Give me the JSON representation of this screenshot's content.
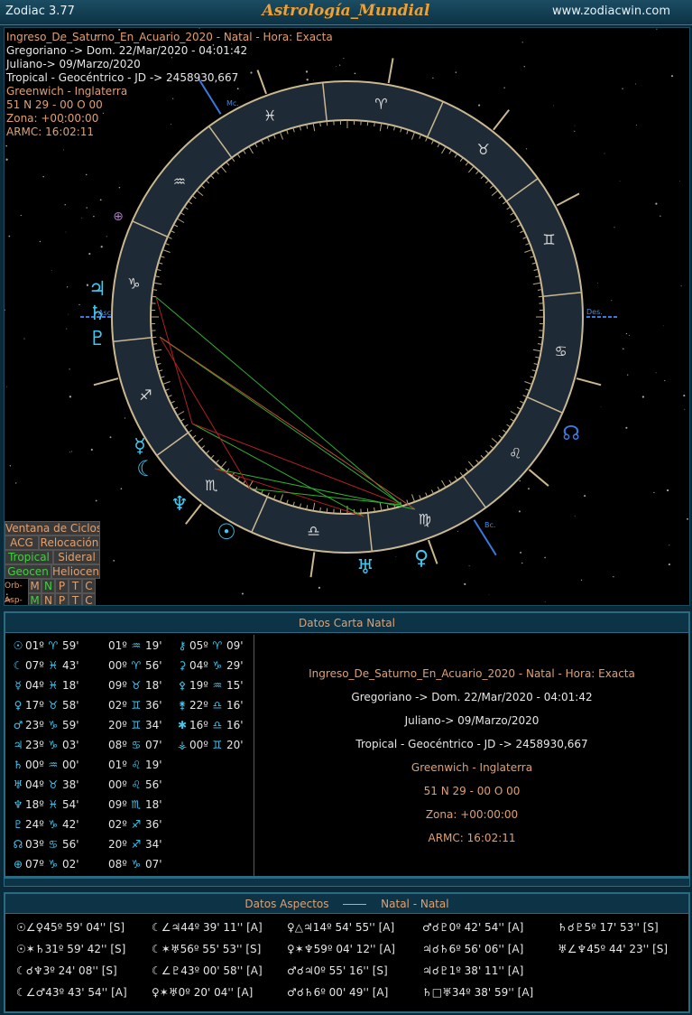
{
  "window": {
    "app_name": "Zodiac 3.77",
    "heading": "Astrología_Mundial",
    "url": "www.zodiacwin.com"
  },
  "chart_info": [
    "Ingreso_De_Saturno_En_Acuario_2020 - Natal - Hora: Exacta",
    "Gregoriano -> Dom. 22/Mar/2020 - 04:01:42",
    "Juliano-> 09/Marzo/2020",
    "Tropical - Geocéntrico - JD -> 2458930,667",
    "Greenwich - Inglaterra",
    "51 N 29 - 00 O 00",
    "Zona: +00:00:00",
    "ARMC: 16:02:11"
  ],
  "wheel": {
    "angle_labels": {
      "mc": "Mc.",
      "asc": "Asc",
      "des": "Des.",
      "bc": "Bc."
    },
    "signs": [
      "♑",
      "♒",
      "♓",
      "♈",
      "♉",
      "♊",
      "♋",
      "♌",
      "♍",
      "♎",
      "♏",
      "♐"
    ]
  },
  "controls": {
    "ventana_ciclos": "Ventana de Ciclos",
    "acg": "ACG",
    "relocacion": "Relocación",
    "tropical": "Tropical",
    "sideral": "Sideral",
    "geocen": "Geocen",
    "heliocen": "Heliocen",
    "orb_label": "Orb->",
    "asp_label": "Asp->",
    "letters": [
      "M",
      "N",
      "P",
      "T",
      "C"
    ]
  },
  "natal": {
    "header": "Datos Carta Natal",
    "col1": [
      {
        "g": "☉",
        "deg": "01º",
        "s": "♈",
        "min": "59'"
      },
      {
        "g": "☾",
        "deg": "07º",
        "s": "♓",
        "min": "43'"
      },
      {
        "g": "☿",
        "deg": "04º",
        "s": "♓",
        "min": "18'"
      },
      {
        "g": "♀",
        "deg": "17º",
        "s": "♉",
        "min": "58'"
      },
      {
        "g": "♂",
        "deg": "23º",
        "s": "♑",
        "min": "59'"
      },
      {
        "g": "♃",
        "deg": "23º",
        "s": "♑",
        "min": "03'"
      },
      {
        "g": "♄",
        "deg": "00º",
        "s": "♒",
        "min": "00'"
      },
      {
        "g": "♅",
        "deg": "04º",
        "s": "♉",
        "min": "38'"
      },
      {
        "g": "♆",
        "deg": "18º",
        "s": "♓",
        "min": "54'"
      },
      {
        "g": "♇",
        "deg": "24º",
        "s": "♑",
        "min": "42'"
      },
      {
        "g": "☊",
        "deg": "03º",
        "s": "♋",
        "min": "56'"
      },
      {
        "g": "⊕",
        "deg": "07º",
        "s": "♑",
        "min": "02'"
      }
    ],
    "col2": [
      {
        "deg": "01º",
        "s": "♒",
        "min": "19'"
      },
      {
        "deg": "00º",
        "s": "♈",
        "min": "56'"
      },
      {
        "deg": "09º",
        "s": "♉",
        "min": "18'"
      },
      {
        "deg": "02º",
        "s": "♊",
        "min": "36'"
      },
      {
        "deg": "20º",
        "s": "♊",
        "min": "34'"
      },
      {
        "deg": "08º",
        "s": "♋",
        "min": "07'"
      },
      {
        "deg": "01º",
        "s": "♌",
        "min": "19'"
      },
      {
        "deg": "00º",
        "s": "♌",
        "min": "56'"
      },
      {
        "deg": "09º",
        "s": "♏",
        "min": "18'"
      },
      {
        "deg": "02º",
        "s": "♐",
        "min": "36'"
      },
      {
        "deg": "20º",
        "s": "♐",
        "min": "34'"
      },
      {
        "deg": "08º",
        "s": "♑",
        "min": "07'"
      }
    ],
    "col3": [
      {
        "g": "⚷",
        "deg": "05º",
        "s": "♈",
        "min": "09'"
      },
      {
        "g": "⚳",
        "deg": "04º",
        "s": "♑",
        "min": "29'"
      },
      {
        "g": "⚴",
        "deg": "19º",
        "s": "♒",
        "min": "15'"
      },
      {
        "g": "⚵",
        "deg": "22º",
        "s": "♎",
        "min": "16'"
      },
      {
        "g": "✱",
        "deg": "16º",
        "s": "♎",
        "min": "16'"
      },
      {
        "g": "⚶",
        "deg": "00º",
        "s": "♊",
        "min": "20'"
      }
    ]
  },
  "aspects": {
    "header_left": "Datos Aspectos",
    "header_right": "Natal - Natal",
    "rows": [
      [
        "☉∠♀45º 59' 04'' [S]",
        "☾∠♃44º 39' 11'' [A]",
        "♀△♃14º 54' 55'' [A]",
        "♂☌♇0º 42' 54'' [A]",
        "♄☌♇5º 17' 53'' [S]"
      ],
      [
        "☉✶♄31º 59' 42'' [S]",
        "☾✶♅56º 55' 53'' [S]",
        "♀✶♆59º 04' 12'' [A]",
        "♃☌♄6º 56' 06'' [A]",
        "♅∠♆45º 44' 23'' [S]"
      ],
      [
        "☾☌♆3º 24' 08'' [S]",
        "☾∠♇43º 00' 58'' [A]",
        "♂☌♃0º 55' 16'' [S]",
        "♃☌♇1º 38' 11'' [A]",
        ""
      ],
      [
        "☾∠♂43º 43' 54'' [A]",
        "♀✶♅0º 20' 04'' [A]",
        "♂☌♄6º 00' 49'' [A]",
        "♄□♅34º 38' 59'' [A]",
        ""
      ]
    ]
  }
}
